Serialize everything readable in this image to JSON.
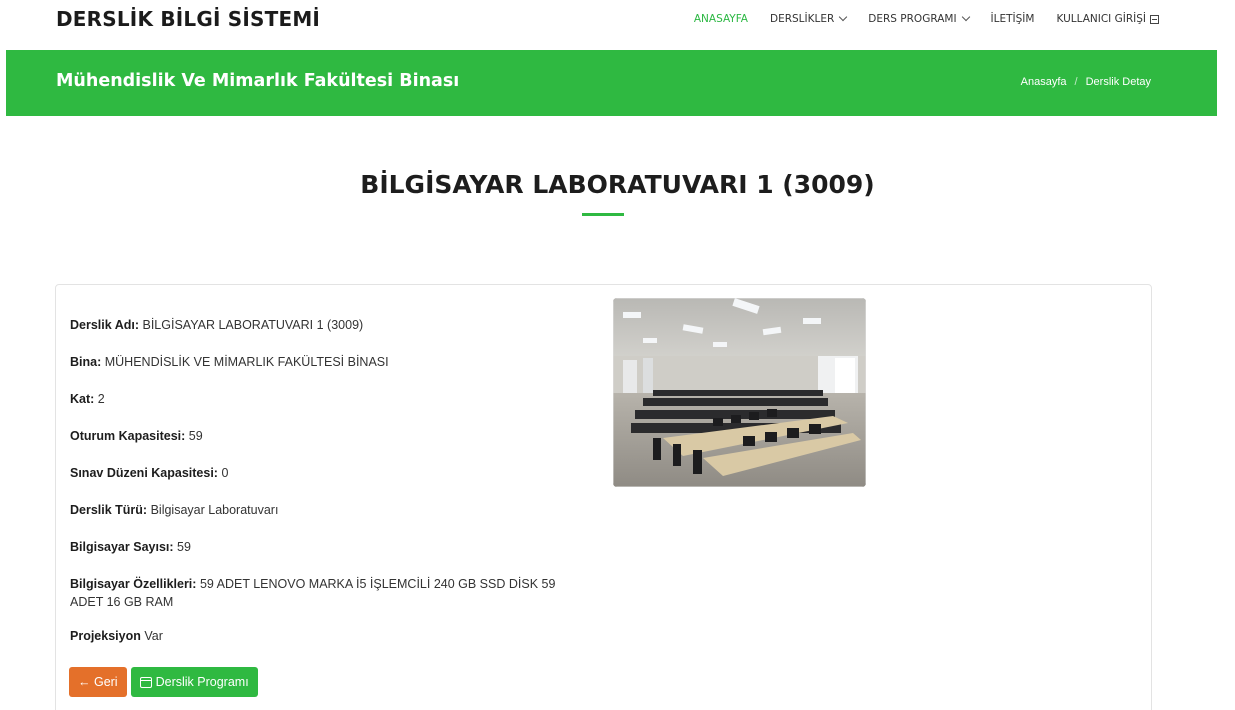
{
  "header": {
    "logo": "DERSLİK BİLGİ SİSTEMİ",
    "nav": [
      {
        "label": "ANASAYFA",
        "active": true
      },
      {
        "label": "DERSLİKLER",
        "dropdown": true
      },
      {
        "label": "DERS PROGRAMI",
        "dropdown": true
      },
      {
        "label": "İLETİŞİM"
      },
      {
        "label": "KULLANICI GİRİŞİ",
        "icon": "login-icon"
      }
    ]
  },
  "banner": {
    "title": "Mühendislik Ve Mimarlık Fakültesi Binası",
    "breadcrumb": [
      "Anasayfa",
      "/",
      "Derslik Detay"
    ]
  },
  "page": {
    "title": "BİLGİSAYAR LABORATUVARI 1 (3009)"
  },
  "details": [
    {
      "label": "Derslik Adı:",
      "value": "BİLGİSAYAR LABORATUVARI 1 (3009)"
    },
    {
      "label": "Bina:",
      "value": "MÜHENDİSLİK VE MİMARLIK FAKÜLTESİ BİNASI"
    },
    {
      "label": "Kat:",
      "value": "2"
    },
    {
      "label": "Oturum Kapasitesi:",
      "value": "59"
    },
    {
      "label": "Sınav Düzeni Kapasitesi:",
      "value": "0"
    },
    {
      "label": "Derslik Türü:",
      "value": "Bilgisayar Laboratuvarı"
    },
    {
      "label": "Bilgisayar Sayısı:",
      "value": "59"
    },
    {
      "label": "Bilgisayar Özellikleri:",
      "value": "59 ADET LENOVO MARKA İ5 İŞLEMCİLİ 240 GB SSD DİSK 59 ADET 16 GB RAM"
    },
    {
      "label": "Projeksiyon",
      "value": "Var"
    }
  ],
  "buttons": {
    "back": "← Geri",
    "program": "Derslik Programı"
  },
  "colors": {
    "accent": "#2fb941",
    "back_button": "#e4702a",
    "nav_active": "#2bb742"
  }
}
